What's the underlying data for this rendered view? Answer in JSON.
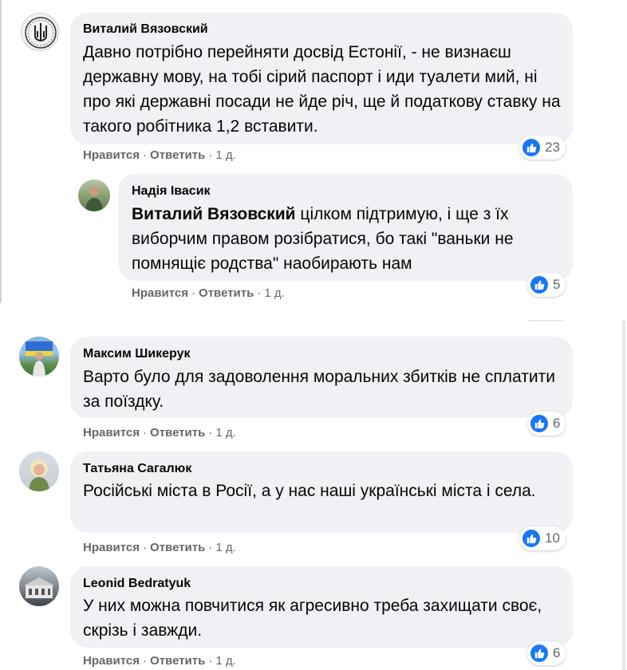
{
  "comments": [
    {
      "author": "Виталий Вязовский",
      "text": "Давно потрібно перейняти досвід Естонії, - не визнаєш державну мову, на тобі сірий паспорт і иди туалети мий, ні про які державні посади не йде річ, ще й податкову ставку на такого робітника 1,2 вставити.",
      "like_label": "Нравится",
      "reply_label": "Ответить",
      "time": "1 д.",
      "reactions": "23"
    },
    {
      "author": "Надія Івасик",
      "mention": "Виталий Вязовский",
      "text": " цілком підтримую, і ще з їх виборчим правом розібратися, бо такі \"ваньки не помнящіє родства\" наобирають нам",
      "like_label": "Нравится",
      "reply_label": "Ответить",
      "time": "1 д.",
      "reactions": "5"
    },
    {
      "author": "Максим Шикерук",
      "text": "Варто було для задоволення моральних збитків не сплатити за поїздку.",
      "like_label": "Нравится",
      "reply_label": "Ответить",
      "time": "1 д.",
      "reactions": "6"
    },
    {
      "author": "Татьяна Сагалюк",
      "text": "Російські міста в Росії, а у нас наші українські міста і села.",
      "like_label": "Нравится",
      "reply_label": "Ответить",
      "time": "1 д.",
      "reactions": "10"
    },
    {
      "author": "Leonid Bedratyuk",
      "text": "У них можна повчитися як агресивно треба захищати своє, скрізь і завжди.",
      "like_label": "Нравится",
      "reply_label": "Ответить",
      "time": "1 д.",
      "reactions": "6"
    }
  ],
  "colors": {
    "bubble": "#eff1f4",
    "like_blue": "#1877f2",
    "meta_gray": "#65676b"
  },
  "icons": {
    "reaction": "like-thumb-icon"
  }
}
